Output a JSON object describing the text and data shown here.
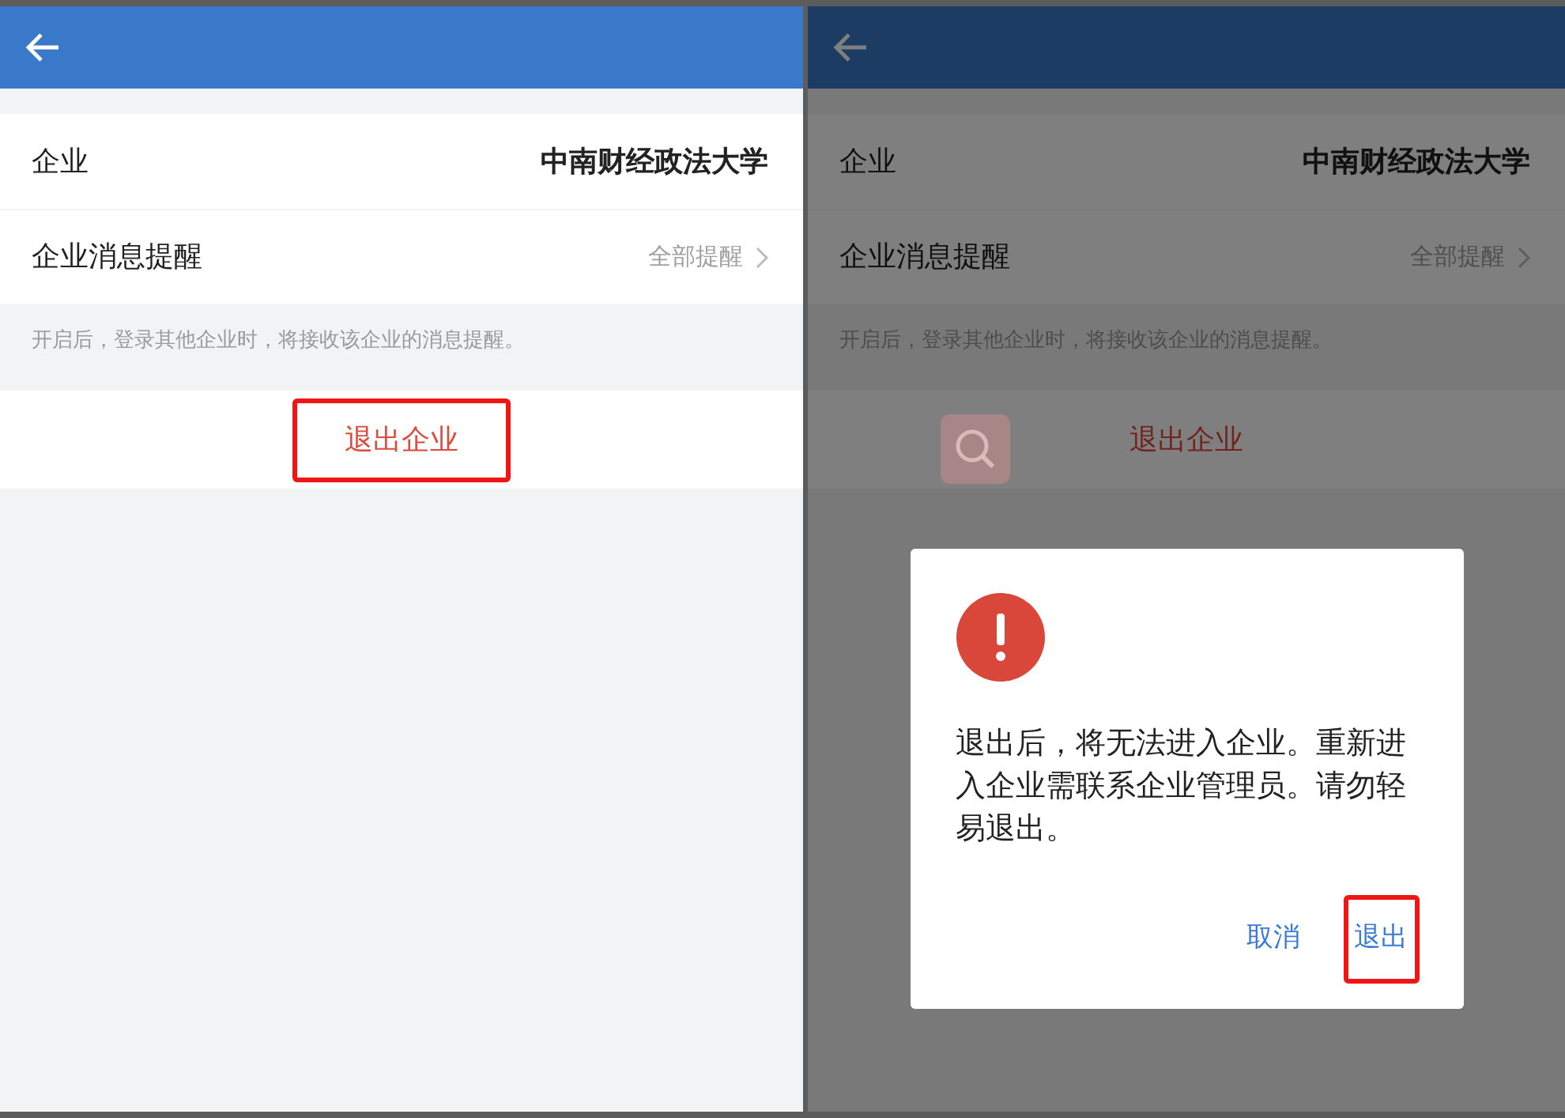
{
  "panels": [
    {
      "dimmed": false,
      "search_badge": false,
      "rows": [
        {
          "kind": "info",
          "label": "企业",
          "value": "中南财经政法大学"
        },
        {
          "kind": "link",
          "label": "企业消息提醒",
          "value": "全部提醒"
        }
      ],
      "hint": "开启后，登录其他企业时，将接收该企业的消息提醒。",
      "exit_button": {
        "label": "退出企业",
        "highlighted": true
      }
    },
    {
      "dimmed": true,
      "search_badge": true,
      "rows": [
        {
          "kind": "info",
          "label": "企业",
          "value": "中南财经政法大学"
        },
        {
          "kind": "link",
          "label": "企业消息提醒",
          "value": "全部提醒"
        }
      ],
      "hint": "开启后，登录其他企业时，将接收该企业的消息提醒。",
      "exit_button": {
        "label": "退出企业",
        "highlighted": false
      },
      "dialog": {
        "message": "退出后，将无法进入企业。重新进入企业需联系企业管理员。请勿轻易退出。",
        "buttons": [
          {
            "label": "取消",
            "highlighted": false
          },
          {
            "label": "退出",
            "highlighted": true
          }
        ]
      }
    }
  ]
}
